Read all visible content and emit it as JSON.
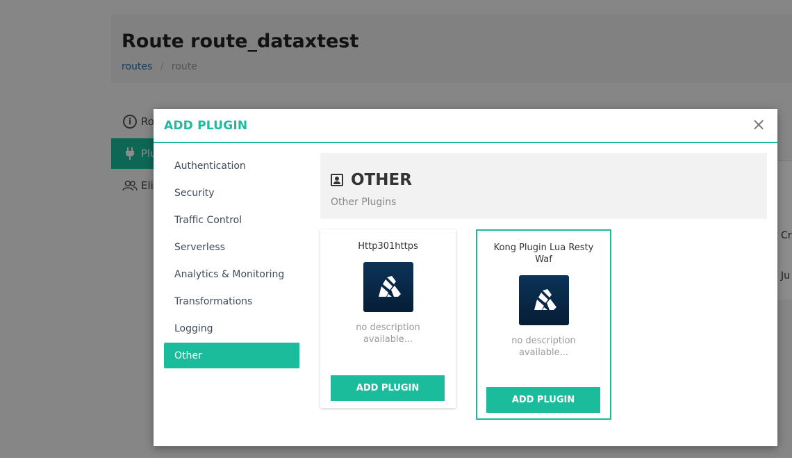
{
  "page": {
    "title": "Route route_dataxtest",
    "breadcrumb": [
      {
        "label": "routes",
        "link": true
      },
      {
        "label": "route",
        "link": false
      }
    ],
    "side_menu": [
      {
        "label": "Ro",
        "icon": "info-icon"
      },
      {
        "label": "Plu",
        "icon": "plug-icon"
      },
      {
        "label": "Eli",
        "icon": "users-icon"
      }
    ],
    "right_cells": [
      "Cr",
      "Ju"
    ]
  },
  "modal": {
    "title": "ADD PLUGIN",
    "close_label": "×",
    "categories": [
      {
        "label": "Authentication"
      },
      {
        "label": "Security"
      },
      {
        "label": "Traffic Control"
      },
      {
        "label": "Serverless"
      },
      {
        "label": "Analytics & Monitoring"
      },
      {
        "label": "Transformations"
      },
      {
        "label": "Logging"
      },
      {
        "label": "Other"
      }
    ],
    "active_category": "Other",
    "section": {
      "title": "OTHER",
      "icon": "contact-card-icon",
      "description": "Other Plugins"
    },
    "plugins": [
      {
        "name": "Http301https",
        "description": "no description available...",
        "button": "ADD PLUGIN"
      },
      {
        "name": "Kong Plugin Lua Resty Waf",
        "description": "no description available...",
        "button": "ADD PLUGIN"
      }
    ],
    "accent_color": "#1abc9c"
  }
}
